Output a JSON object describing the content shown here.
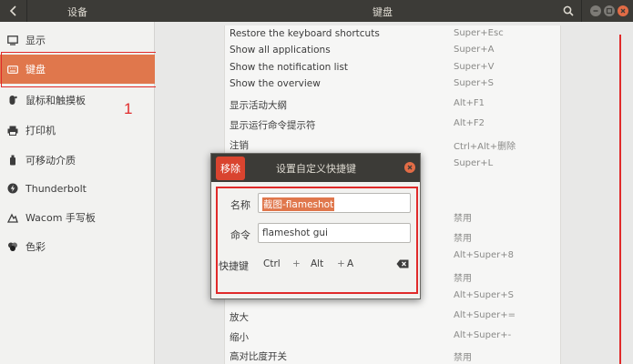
{
  "header": {
    "left_title": "设备",
    "title": "键盘"
  },
  "sidebar": {
    "items": [
      {
        "label": "显示",
        "icon": "display-icon"
      },
      {
        "label": "键盘",
        "icon": "keyboard-icon",
        "active": true
      },
      {
        "label": "鼠标和触摸板",
        "icon": "mouse-icon"
      },
      {
        "label": "打印机",
        "icon": "printer-icon"
      },
      {
        "label": "可移动介质",
        "icon": "usb-icon"
      },
      {
        "label": "Thunderbolt",
        "icon": "thunderbolt-icon"
      },
      {
        "label": "Wacom 手写板",
        "icon": "tablet-icon"
      },
      {
        "label": "色彩",
        "icon": "color-icon"
      }
    ],
    "annotation": "1"
  },
  "shortcuts": [
    {
      "name": "Restore the keyboard shortcuts",
      "key": "Super+Esc"
    },
    {
      "name": "Show all applications",
      "key": "Super+A"
    },
    {
      "name": "Show the notification list",
      "key": "Super+V"
    },
    {
      "name": "Show the overview",
      "key": "Super+S"
    },
    {
      "name": "显示活动大纲",
      "key": "Alt+F1"
    },
    {
      "name": "显示运行命令提示符",
      "key": "Alt+F2"
    },
    {
      "name": "注销",
      "key": "Ctrl+Alt+删除"
    },
    {
      "name": "",
      "key": "Super+L"
    },
    {
      "name": "",
      "key": ""
    },
    {
      "name": "",
      "key": "禁用"
    },
    {
      "name": "",
      "key": "禁用"
    },
    {
      "name": "",
      "key": "Alt+Super+8"
    },
    {
      "name": "",
      "key": "禁用"
    },
    {
      "name": "",
      "key": "Alt+Super+S"
    },
    {
      "name": "放大",
      "key": "Alt+Super+="
    },
    {
      "name": "缩小",
      "key": "Alt+Super+-"
    },
    {
      "name": "高对比度开关",
      "key": "禁用"
    }
  ],
  "dialog": {
    "remove_label": "移除",
    "title": "设置自定义快捷键",
    "name_label": "名称",
    "name_value": "截图-flameshot",
    "command_label": "命令",
    "command_value": "flameshot gui",
    "shortcut_label": "快捷键",
    "keys": [
      "Ctrl",
      "+",
      "Alt",
      "+",
      "A"
    ]
  },
  "colors": {
    "accent": "#e0774c",
    "annotation": "#e02a2a",
    "header_bg": "#3c3b37"
  }
}
